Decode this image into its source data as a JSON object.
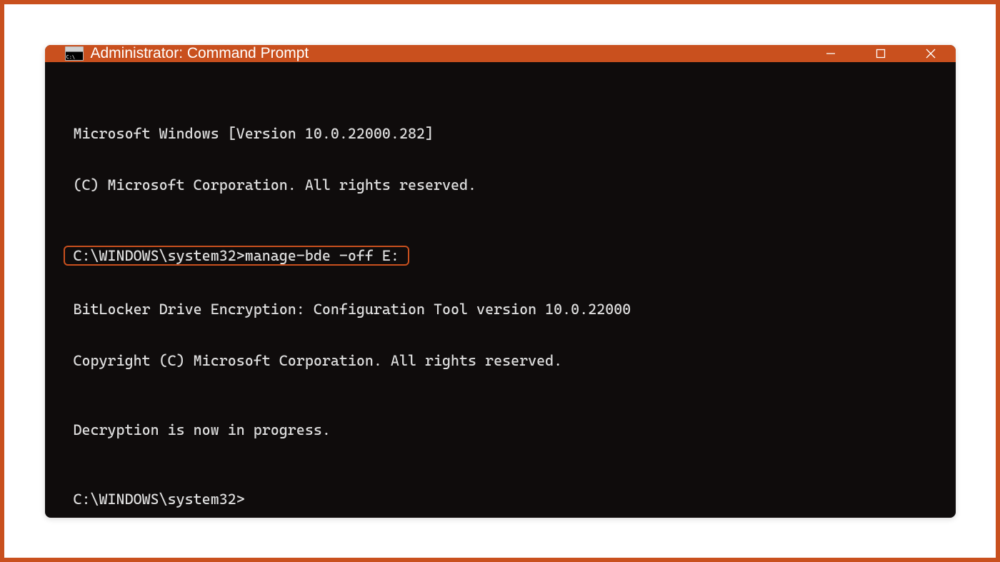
{
  "window": {
    "title": "Administrator: Command Prompt",
    "icon_name": "cmd-icon",
    "accent_color": "#c9501e"
  },
  "terminal": {
    "lines": {
      "l1": "Microsoft Windows [Version 10.0.22000.282]",
      "l2": "(C) Microsoft Corporation. All rights reserved.",
      "cmd_line": "C:\\WINDOWS\\system32>manage-bde -off E:",
      "l3": "BitLocker Drive Encryption: Configuration Tool version 10.0.22000",
      "l4": "Copyright (C) Microsoft Corporation. All rights reserved.",
      "l5": "Decryption is now in progress.",
      "prompt2": "C:\\WINDOWS\\system32>"
    }
  }
}
